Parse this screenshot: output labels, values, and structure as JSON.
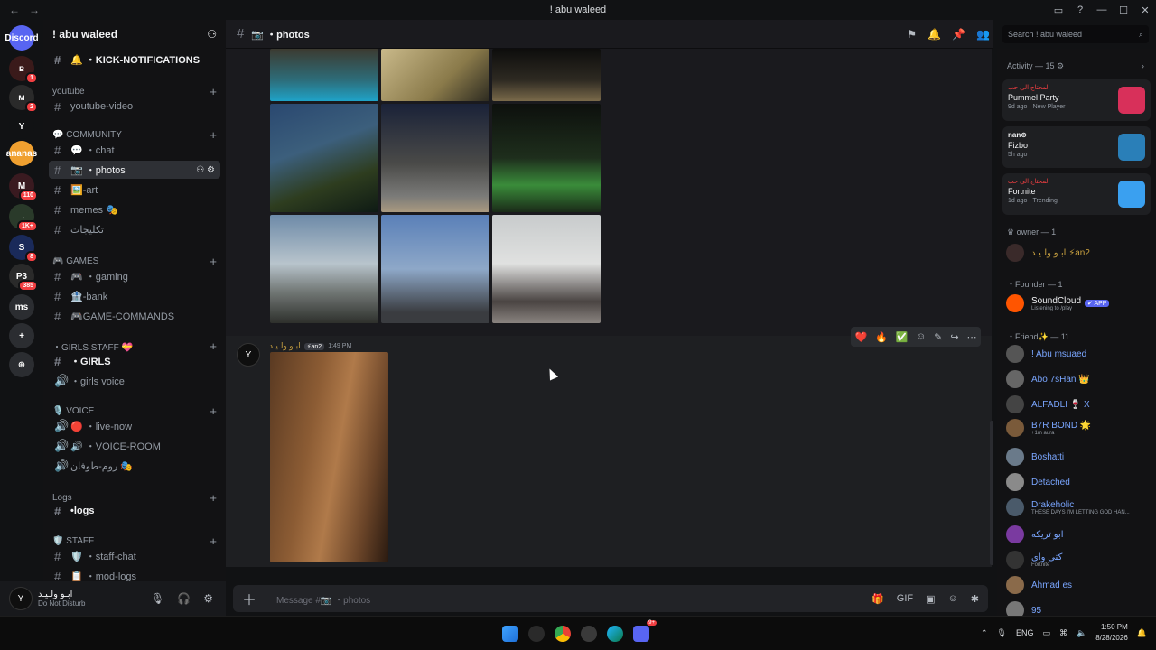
{
  "window": {
    "title": "! abu waleed",
    "nav_back": "←",
    "nav_forward": "→"
  },
  "servers": [
    {
      "label": "Discord",
      "badge": ""
    },
    {
      "label": "ʙ",
      "badge": "1"
    },
    {
      "label": "ᴍ",
      "badge": "2"
    },
    {
      "label": "Y",
      "badge": ""
    },
    {
      "label": "ananas",
      "badge": ""
    },
    {
      "label": "M",
      "badge": "110"
    },
    {
      "label": "→",
      "badge": "1K+"
    },
    {
      "label": "S",
      "badge": "8"
    },
    {
      "label": "P3",
      "badge": "385"
    },
    {
      "label": "ms",
      "badge": ""
    },
    {
      "label": "+",
      "badge": ""
    },
    {
      "label": "⊕",
      "badge": ""
    }
  ],
  "server_name": "! abu waleed",
  "channels": [
    {
      "kind": "channel",
      "label": "🔔 ・KICK-NOTIFICATIONS",
      "bold": true
    },
    {
      "kind": "category",
      "label": "youtube"
    },
    {
      "kind": "channel",
      "label": "youtube-video"
    },
    {
      "kind": "category",
      "label": "💬 COMMUNITY"
    },
    {
      "kind": "channel",
      "label": "💬 ・chat"
    },
    {
      "kind": "channel",
      "label": "📷 ・photos",
      "active": true
    },
    {
      "kind": "channel",
      "label": "🖼️-art"
    },
    {
      "kind": "channel",
      "label": "memes 🎭"
    },
    {
      "kind": "channel",
      "label": "تكليجات"
    },
    {
      "kind": "category",
      "label": "🎮 GAMES"
    },
    {
      "kind": "channel",
      "label": "🎮 ・gaming"
    },
    {
      "kind": "channel",
      "label": "🏦-bank"
    },
    {
      "kind": "channel",
      "label": "🎮GAME-COMMANDS"
    },
    {
      "kind": "category",
      "label": "・GIRLS STAFF 💝"
    },
    {
      "kind": "channel",
      "label": "・GIRLS",
      "bold": true
    },
    {
      "kind": "voice",
      "label": "・girls voice"
    },
    {
      "kind": "category",
      "label": "🎙️ VOICE"
    },
    {
      "kind": "voice",
      "label": "🔴 ・live-now"
    },
    {
      "kind": "voice",
      "label": "🔊 ・VOICE-ROOM"
    },
    {
      "kind": "voice",
      "label": "روم-طوفان 🎭"
    },
    {
      "kind": "category",
      "label": "Logs"
    },
    {
      "kind": "channel",
      "label": "•logs",
      "bold": true
    },
    {
      "kind": "category",
      "label": "🛡️ STAFF"
    },
    {
      "kind": "channel",
      "label": "🛡️ ・staff-chat"
    },
    {
      "kind": "channel",
      "label": "📋 ・mod-logs"
    }
  ],
  "user_panel": {
    "avatar": "Y",
    "name": "ابـو ولـيـد",
    "status": "Do Not Disturb"
  },
  "topbar": {
    "channel": "📷 ・photos"
  },
  "search": {
    "placeholder": "Search ! abu waleed"
  },
  "message": {
    "avatar": "Y",
    "author": "ابـو ولـيـد",
    "tag": "⚡an2",
    "time": "1:49 PM"
  },
  "hover_reactions": [
    "❤️",
    "🔥",
    "✅",
    "☺",
    "✎",
    "↪",
    "⋯"
  ],
  "composer": {
    "placeholder": "Message #📷 ・photos"
  },
  "activity": {
    "header": "Activity — 15 ⚙",
    "cards": [
      {
        "user": "المحتاج الى حب",
        "game": "Pummel Party",
        "meta": "9d ago · New Player",
        "color": "#d8305a"
      },
      {
        "user": "nan⊛",
        "game": "Fizbo",
        "meta": "5h ago",
        "color": "#2a7fb8"
      },
      {
        "user": "المحتاج الى حب",
        "game": "Fortnite",
        "meta": "1d ago · Trending",
        "color": "#3aa0f0"
      }
    ]
  },
  "member_groups": [
    {
      "role": "♛ owner — 1",
      "members": [
        {
          "name": "ابـو ولـيـد ⚡an2",
          "sub": ""
        }
      ]
    },
    {
      "role": "・Founder — 1",
      "members": [
        {
          "name": "SoundCloud",
          "sub": "Listening to /play",
          "tag": "✔ APP"
        }
      ]
    },
    {
      "role": "・Friend✨ — 11",
      "members": [
        {
          "name": "! Abu msuaed",
          "sub": ""
        },
        {
          "name": "Abo 7sHan 👑",
          "sub": ""
        },
        {
          "name": "ALFADLI 🍷 X",
          "sub": ""
        },
        {
          "name": "B7R BOND 🌟",
          "sub": "+1m aura"
        },
        {
          "name": "Boshatti",
          "sub": ""
        },
        {
          "name": "Detached",
          "sub": ""
        },
        {
          "name": "Drakeholic",
          "sub": "THESE DAYS I'M LETTING GOD HAN..."
        },
        {
          "name": "ابو تريكه",
          "sub": ""
        },
        {
          "name": "كتي واي",
          "sub": "Fortnite"
        },
        {
          "name": "Ahmad es",
          "sub": ""
        },
        {
          "name": "95",
          "sub": ""
        }
      ]
    }
  ],
  "taskbar": {
    "lang": "ENG",
    "time": "1:50 PM",
    "date": "8/28/2026",
    "discord_badge": "9+"
  }
}
